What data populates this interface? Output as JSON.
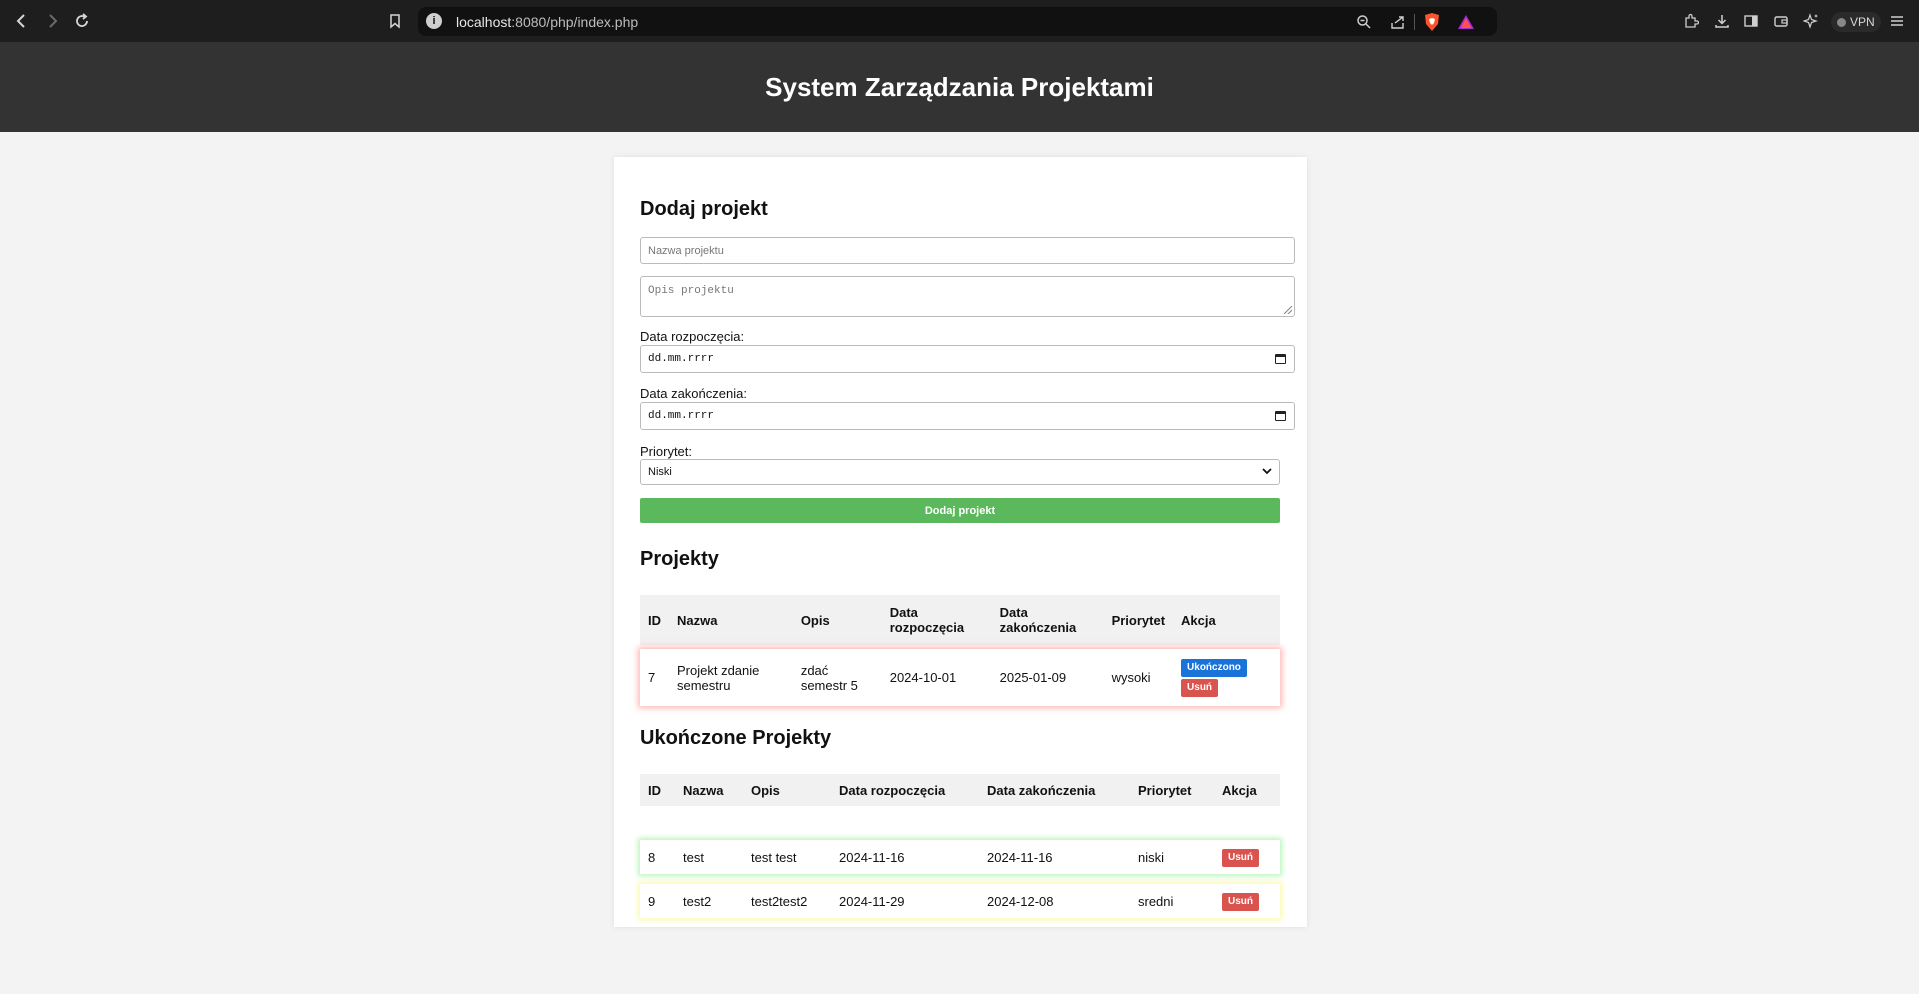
{
  "browser": {
    "url_host": "localhost",
    "url_rest": ":8080/php/index.php",
    "vpn_label": "VPN",
    "icons": [
      "back-icon",
      "forward-icon",
      "reload-icon",
      "bookmark-icon",
      "site-info-icon",
      "zoom-icon",
      "share-icon",
      "brave-shields-icon",
      "brave-rewards-icon",
      "extensions-icon",
      "downloads-icon",
      "sidebar-icon",
      "wallet-icon",
      "leo-ai-icon",
      "menu-icon"
    ]
  },
  "header": {
    "title": "System Zarządzania Projektami"
  },
  "form": {
    "heading": "Dodaj projekt",
    "name_placeholder": "Nazwa projektu",
    "desc_placeholder": "Opis projektu",
    "start_label": "Data rozpoczęcia:",
    "start_value": "dd.mm.rrrr",
    "end_label": "Data zakończenia:",
    "end_value": "dd.mm.rrrr",
    "priority_label": "Priorytet:",
    "priority_value": "Niski",
    "submit_label": "Dodaj projekt"
  },
  "projects": {
    "heading": "Projekty",
    "columns": [
      "ID",
      "Nazwa",
      "Opis",
      "Data rozpoczęcia",
      "Data zakończenia",
      "Priorytet",
      "Akcja"
    ],
    "rows": [
      {
        "id": "7",
        "name": "Projekt zdanie semestru",
        "desc": "zdać semestr 5",
        "start": "2024-10-01",
        "end": "2025-01-09",
        "priority": "wysoki",
        "done_label": "Ukończono",
        "delete_label": "Usuń"
      }
    ]
  },
  "completed": {
    "heading": "Ukończone Projekty",
    "columns": [
      "ID",
      "Nazwa",
      "Opis",
      "Data rozpoczęcia",
      "Data zakończenia",
      "Priorytet",
      "Akcja"
    ],
    "rows": [
      {
        "id": "8",
        "name": "test",
        "desc": "test test",
        "start": "2024-11-16",
        "end": "2024-11-16",
        "priority": "niski",
        "delete_label": "Usuń"
      },
      {
        "id": "9",
        "name": "test2",
        "desc": "test2test2",
        "start": "2024-11-29",
        "end": "2024-12-08",
        "priority": "sredni",
        "delete_label": "Usuń"
      }
    ]
  },
  "colors": {
    "header_bg": "#333333",
    "submit_bg": "#5cb85c",
    "done_btn": "#1a73d9",
    "delete_btn": "#d9534f",
    "high_priority_glow": "#ff7878",
    "low_priority_glow": "#96f096",
    "mid_priority_glow": "#fafa96"
  }
}
